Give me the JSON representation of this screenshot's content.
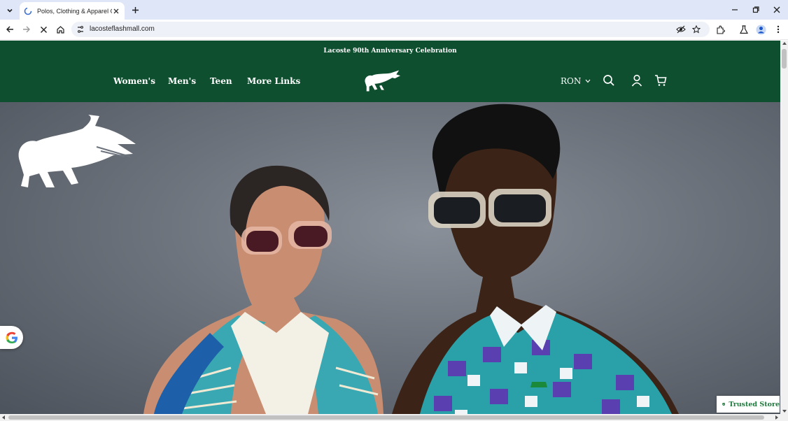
{
  "browser": {
    "tab": {
      "title": "Polos, Clothing & Apparel Online",
      "favicon": "chrome-loading-icon"
    },
    "url": "lacosteflashmall.com",
    "icons": [
      "tab-list-icon",
      "close-icon",
      "new-tab-icon",
      "minimize-icon",
      "restore-icon",
      "window-close-icon",
      "back-arrow-icon",
      "forward-arrow-icon",
      "stop-loading-icon",
      "home-icon",
      "site-info-icon",
      "eye-off-icon",
      "star-icon",
      "extensions-icon",
      "labs-icon",
      "profile-icon",
      "kebab-menu-icon"
    ]
  },
  "site": {
    "announcement": "Lacoste 90th Anniversary Celebration",
    "nav": [
      "Women's",
      "Men's",
      "Teen",
      "More Links"
    ],
    "currency": "RON",
    "icons": [
      "crocodile-logo-icon",
      "chevron-down-icon",
      "search-icon",
      "account-icon",
      "cart-icon"
    ],
    "brand_color": "#0d4f2e"
  },
  "hero": {
    "image": "two models wearing sunglasses and patterned shirts",
    "logo": "crocodile-logo-icon"
  },
  "badges": {
    "google": "google-g-icon",
    "trusted": "Trusted Store",
    "trusted_icon": "shield-check-icon",
    "trusted_color": "#1f7a3d"
  }
}
